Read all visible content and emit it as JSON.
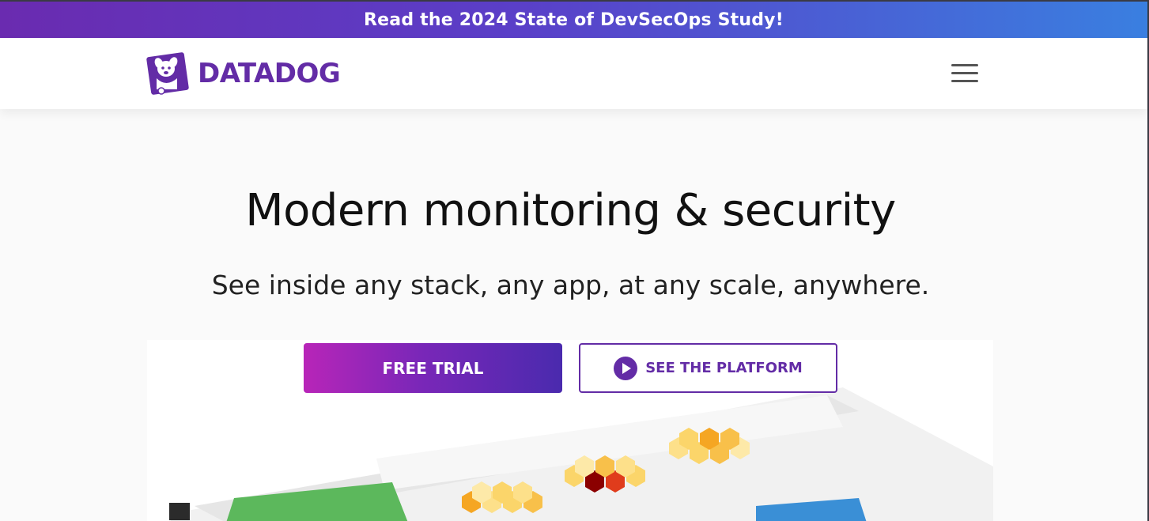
{
  "banner": {
    "text": "Read the 2024 State of DevSecOps Study!"
  },
  "navbar": {
    "logo_text": "DATADOG",
    "logo_icon": "datadog-dog-icon",
    "menu_icon": "hamburger-menu-icon"
  },
  "hero": {
    "title": "Modern monitoring & security",
    "subtitle": "See inside any stack, any app, at any scale, anywhere."
  },
  "cta": {
    "free_trial_label": "FREE TRIAL",
    "platform_label": "SEE THE PLATFORM",
    "platform_icon": "play-icon"
  },
  "colors": {
    "brand_purple": "#632ca6",
    "banner_gradient_start": "#6a2bb0",
    "banner_gradient_end": "#3a7fe0"
  }
}
